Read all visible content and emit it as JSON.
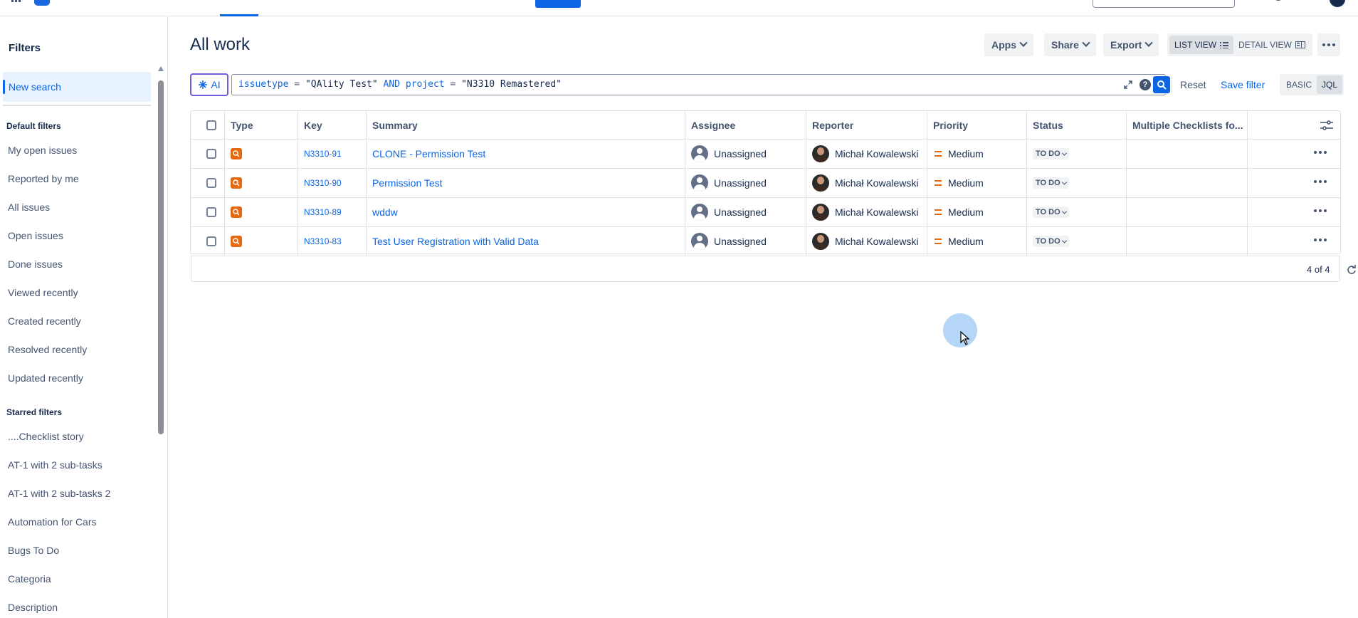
{
  "topnav": {
    "icons": [
      "apps-grid-icon",
      "app-logo",
      "search-fragment-icon",
      "apps-fragment-icon",
      "notifications-icon",
      "help-icon",
      "settings-icon",
      "profile-avatar"
    ]
  },
  "sidebar": {
    "title": "Filters",
    "new_search": "New search",
    "default_heading": "Default filters",
    "default_items": [
      "My open issues",
      "Reported by me",
      "All issues",
      "Open issues",
      "Done issues",
      "Viewed recently",
      "Created recently",
      "Resolved recently",
      "Updated recently"
    ],
    "starred_heading": "Starred filters",
    "starred_items": [
      "....Checklist story",
      "AT-1 with 2 sub-tasks",
      "AT-1 with 2 sub-tasks 2",
      "Automation for Cars",
      "Bugs To Do",
      "Categoria",
      "Description"
    ]
  },
  "header": {
    "title": "All work",
    "apps": "Apps",
    "share": "Share",
    "export": "Export",
    "list_view": "LIST VIEW",
    "detail_view": "DETAIL VIEW"
  },
  "search": {
    "ai_label": "AI",
    "jql": {
      "f1": "issuetype",
      "op1": " = ",
      "v1": "\"QAlity Test\"",
      "and": " AND ",
      "f2": "project",
      "op2": " = ",
      "v2": "\"N3310 Remastered\""
    },
    "help": "?",
    "reset": "Reset",
    "save_filter": "Save filter",
    "basic": "BASIC",
    "jql_mode": "JQL"
  },
  "table": {
    "columns": [
      "Type",
      "Key",
      "Summary",
      "Assignee",
      "Reporter",
      "Priority",
      "Status",
      "Multiple Checklists fo..."
    ],
    "rows": [
      {
        "key": "N3310-91",
        "summary": "CLONE - Permission Test",
        "assignee": "Unassigned",
        "reporter": "Michał Kowalewski",
        "priority": "Medium",
        "status": "TO DO"
      },
      {
        "key": "N3310-90",
        "summary": "Permission Test",
        "assignee": "Unassigned",
        "reporter": "Michał Kowalewski",
        "priority": "Medium",
        "status": "TO DO"
      },
      {
        "key": "N3310-89",
        "summary": "wddw",
        "assignee": "Unassigned",
        "reporter": "Michał Kowalewski",
        "priority": "Medium",
        "status": "TO DO"
      },
      {
        "key": "N3310-83",
        "summary": "Test User Registration with Valid Data",
        "assignee": "Unassigned",
        "reporter": "Michał Kowalewski",
        "priority": "Medium",
        "status": "TO DO"
      }
    ],
    "count": "4 of 4"
  },
  "colors": {
    "accent": "#0c66e4",
    "type_icon": "#e56910",
    "priority_medium": "#e56910",
    "ai_border": "#6b5fe0"
  }
}
